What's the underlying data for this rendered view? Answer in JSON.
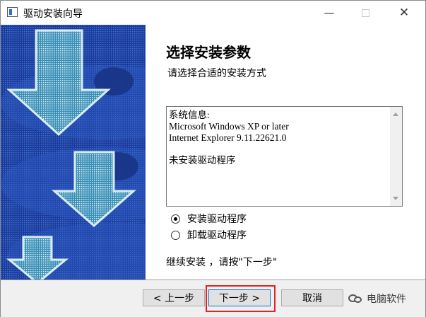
{
  "window": {
    "title": "驱动安装向导",
    "controls": {
      "minimize": "—",
      "close": "✕"
    }
  },
  "main": {
    "heading": "选择安装参数",
    "subheading": "请选择合适的安装方式",
    "info_lines": [
      "系统信息:",
      "Microsoft Windows XP or later",
      "Internet Explorer 9.11.22621.0",
      "",
      "未安装驱动程序"
    ],
    "options": [
      {
        "label": "安装驱动程序",
        "checked": true
      },
      {
        "label": "卸载驱动程序",
        "checked": false
      }
    ],
    "hint": "继续安装 ，请按\"下一步\""
  },
  "buttons": {
    "back": "< 上一步",
    "next": "下一步 >",
    "cancel": "取消"
  },
  "watermark": {
    "text": "电脑软件"
  },
  "colors": {
    "banner_blue": "#1b3a9e",
    "arrow_fill": "#3a8fb7",
    "highlight_red": "#e02424",
    "focus_blue": "#0078d7"
  },
  "icons": [
    "app-icon",
    "minimize-icon",
    "maximize-icon",
    "close-icon",
    "scroll-up-arrow-icon",
    "scroll-down-arrow-icon",
    "down-arrow-graphic",
    "wechat-icon"
  ]
}
